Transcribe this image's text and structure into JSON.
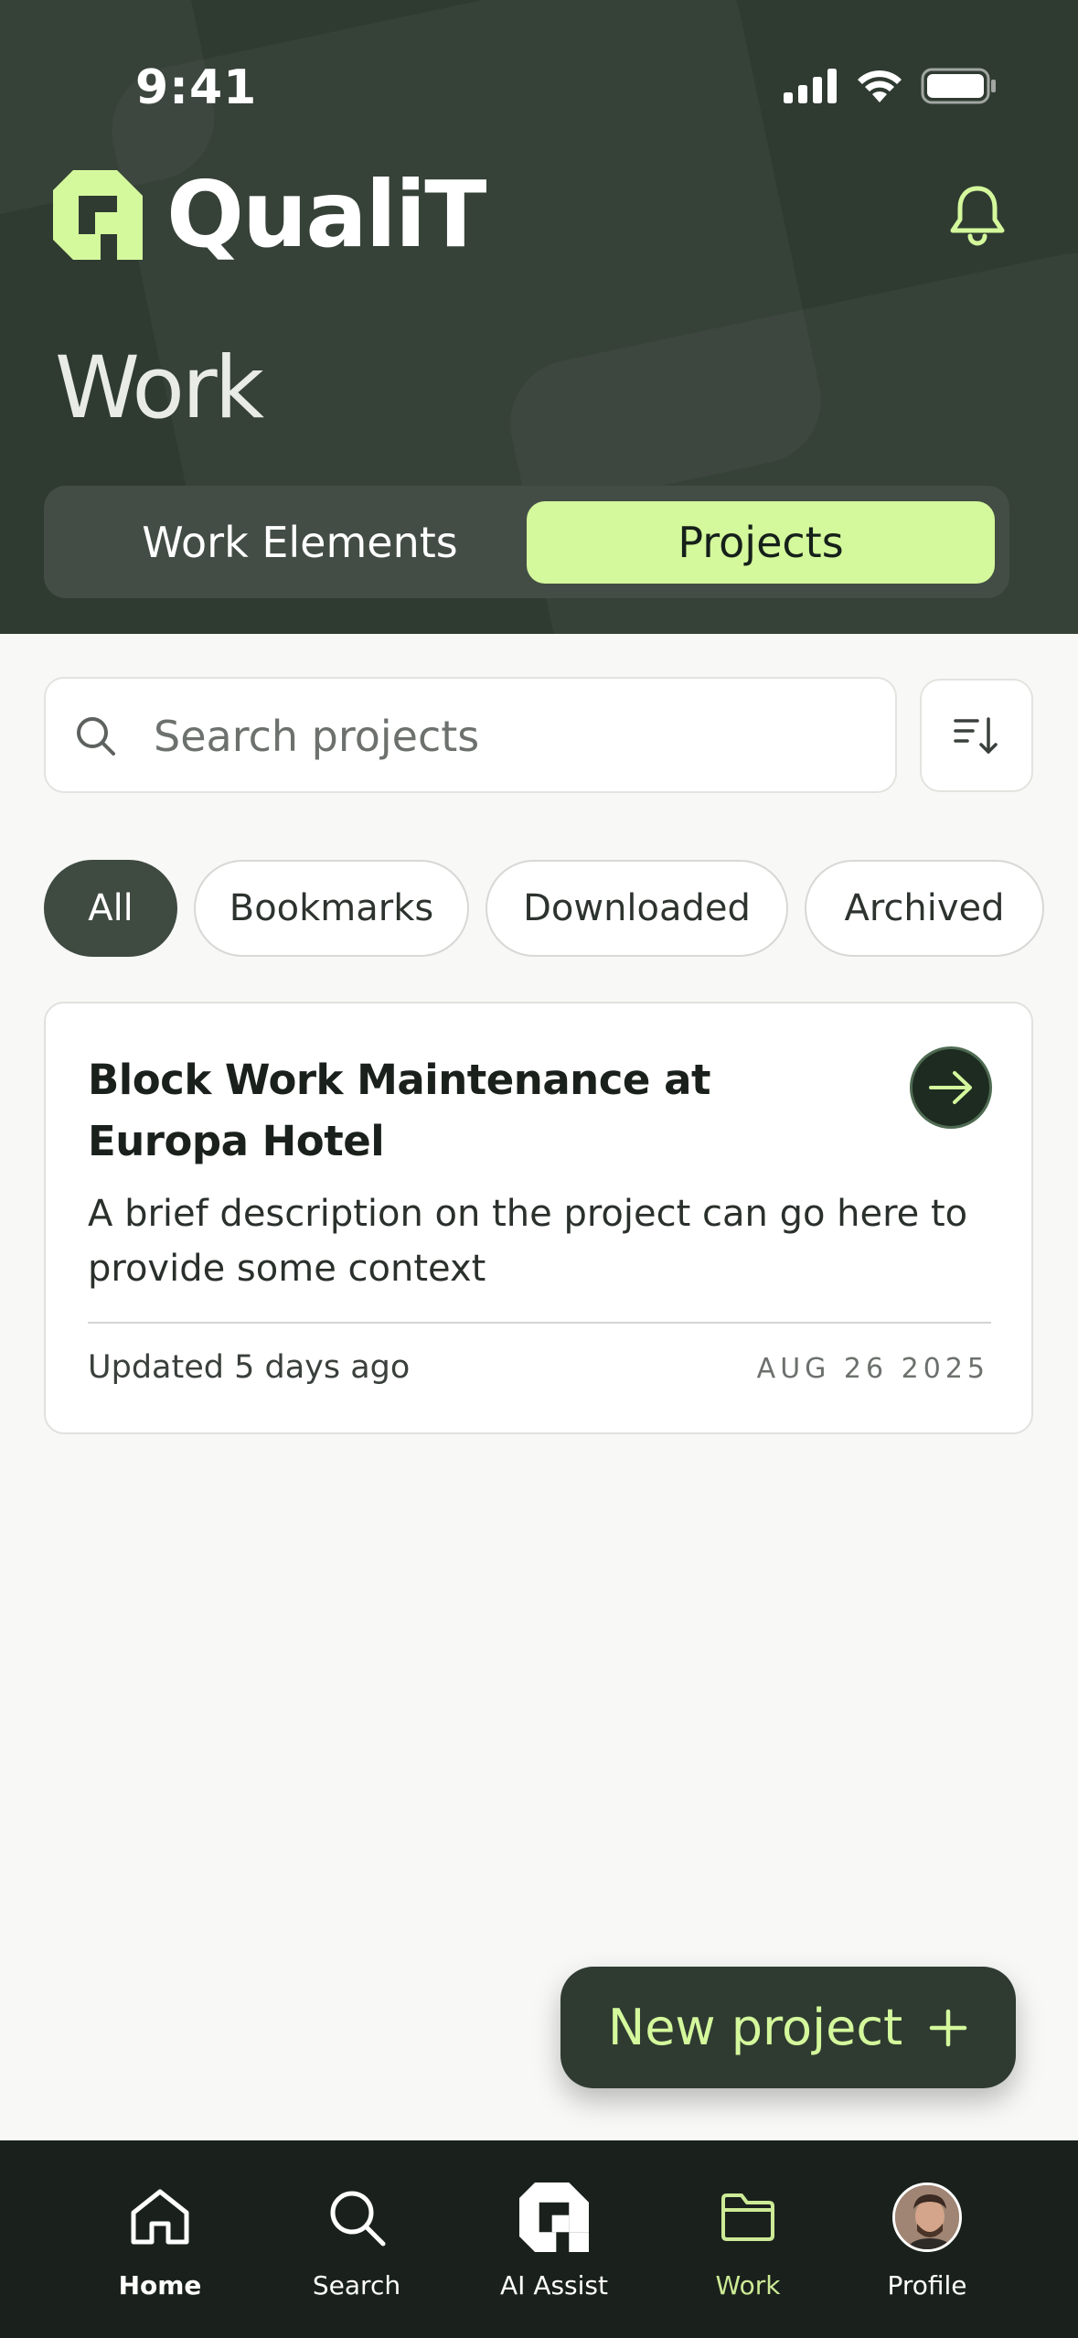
{
  "status_bar": {
    "time": "9:41"
  },
  "header": {
    "app_name": "QualiT",
    "page_title": "Work",
    "segments": [
      {
        "label": "Work Elements",
        "active": false
      },
      {
        "label": "Projects",
        "active": true
      }
    ]
  },
  "search": {
    "placeholder": "Search projects",
    "value": ""
  },
  "filters": [
    {
      "label": "All",
      "active": true
    },
    {
      "label": "Bookmarks",
      "active": false
    },
    {
      "label": "Downloaded",
      "active": false
    },
    {
      "label": "Archived",
      "active": false
    }
  ],
  "projects": [
    {
      "title": "Block Work Maintenance at Europa Hotel",
      "description": "A brief description on the project can go here to provide some context",
      "updated": "Updated 5 days ago",
      "date": "AUG 26 2025"
    }
  ],
  "fab": {
    "label": "New project",
    "icon": "plus-icon"
  },
  "bottom_nav": [
    {
      "label": "Home",
      "icon": "home-icon"
    },
    {
      "label": "Search",
      "icon": "search-icon"
    },
    {
      "label": "AI Assist",
      "icon": "ai-assist-icon"
    },
    {
      "label": "Work",
      "icon": "folder-icon",
      "active": true
    },
    {
      "label": "Profile",
      "icon": "avatar"
    }
  ],
  "colors": {
    "header_bg": "#2f3b31",
    "accent": "#d4f89c",
    "nav_bg": "#1a211c",
    "nav_active": "#cdea96"
  }
}
